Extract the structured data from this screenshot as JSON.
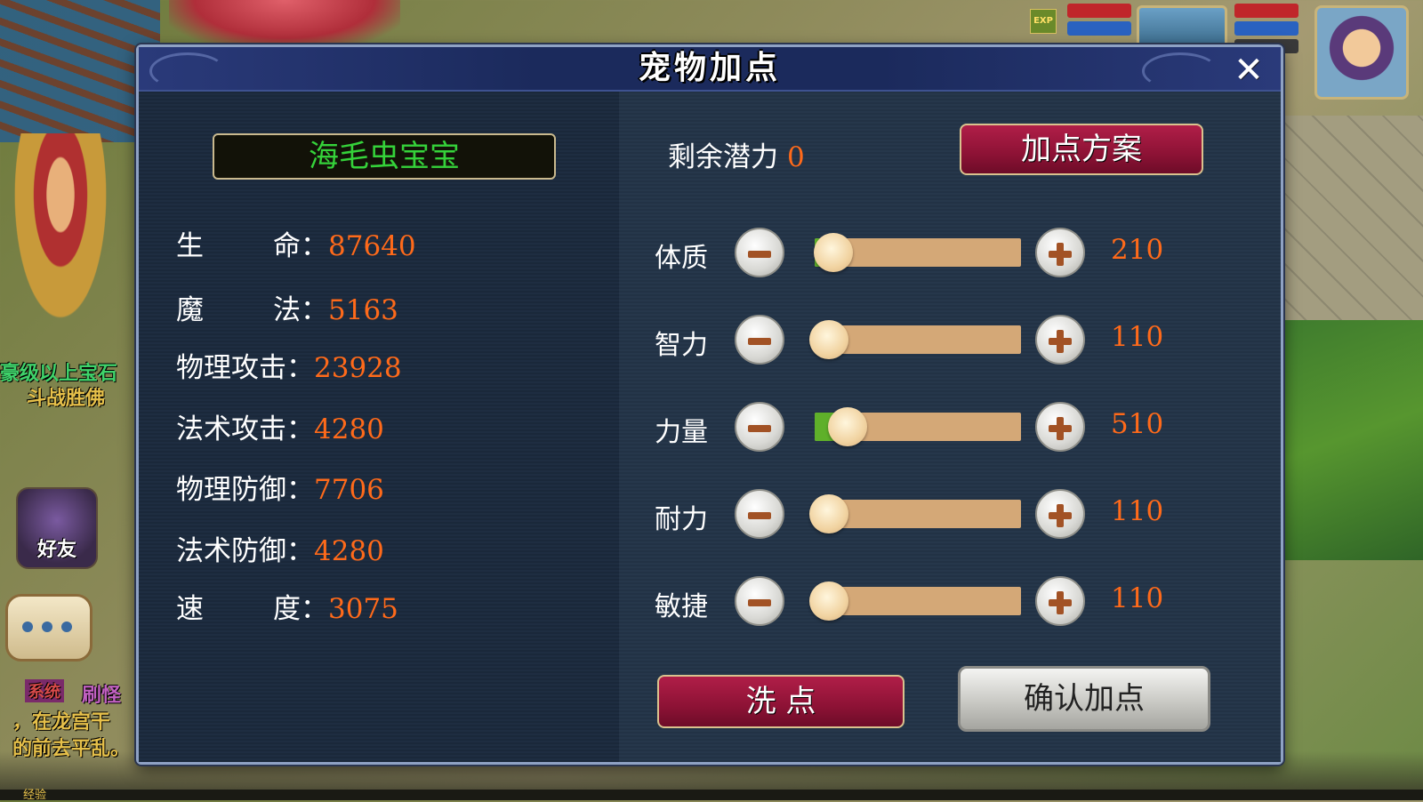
{
  "background": {
    "side_texts": [
      "豪级以上宝石",
      "斗战胜佛",
      "系统",
      "刷怪",
      "，在龙宫干",
      "的前去平乱。"
    ],
    "friend_label": "好友",
    "exp_label": "经验",
    "exp_icon_label": "EXP"
  },
  "dialog": {
    "title": "宠物加点",
    "close_symbol": "✕",
    "pet_name": "海毛虫宝宝",
    "stats": [
      {
        "label_a": "生",
        "label_b": "命",
        "value": "87640"
      },
      {
        "label_a": "魔",
        "label_b": "法",
        "value": "5163"
      },
      {
        "label": "物理攻击",
        "value": "23928"
      },
      {
        "label": "法术攻击",
        "value": "4280"
      },
      {
        "label": "物理防御",
        "value": "7706"
      },
      {
        "label": "法术防御",
        "value": "4280"
      },
      {
        "label_a": "速",
        "label_b": "度",
        "value": "3075"
      }
    ],
    "potential_label": "剩余潜力",
    "potential_value": "0",
    "plan_button": "加点方案",
    "attributes": [
      {
        "label": "体质",
        "value": "210",
        "level": 0.09
      },
      {
        "label": "智力",
        "value": "110",
        "level": 0.07
      },
      {
        "label": "力量",
        "value": "510",
        "level": 0.16
      },
      {
        "label": "耐力",
        "value": "110",
        "level": 0.07
      },
      {
        "label": "敏捷",
        "value": "110",
        "level": 0.07
      }
    ],
    "reset_button": "洗  点",
    "confirm_button": "确认加点"
  },
  "colors": {
    "value_orange": "#ff6a1a",
    "name_green": "#35d23a",
    "slider_fill": "#5fb02a",
    "slider_track": "#d4a877",
    "button_red": "#8d1235"
  }
}
